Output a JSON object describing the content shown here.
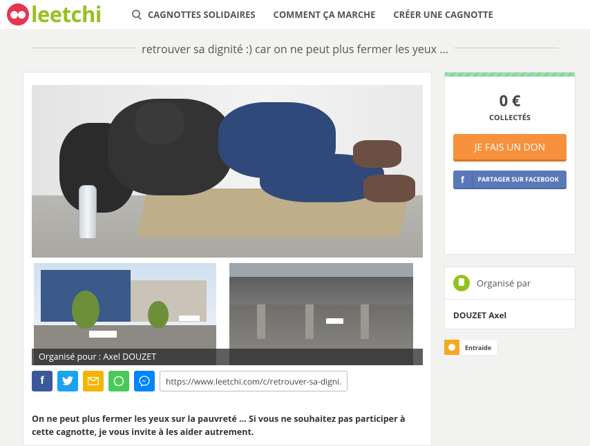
{
  "header": {
    "logo_text": "leetchi",
    "nav": [
      {
        "label": "CAGNOTTES SOLIDAIRES",
        "icon": "search-icon"
      },
      {
        "label": "COMMENT ÇA MARCHE"
      },
      {
        "label": "CRÉER UNE CAGNOTTE"
      }
    ]
  },
  "page": {
    "title": "retrouver sa dignité :) car on ne peut plus fermer les yeux ..."
  },
  "main": {
    "caption": "Organisé pour : Axel DOUZET",
    "share": {
      "icons": [
        "facebook-icon",
        "twitter-icon",
        "email-icon",
        "whatsapp-icon",
        "messenger-icon"
      ],
      "url": "https://www.leetchi.com/c/retrouver-sa-digni..."
    },
    "description": "On ne peut plus fermer les yeux sur la pauvreté ... Si vous ne souhaitez pas participer à cette cagnotte, je vous invite à les aider autrement."
  },
  "sidebar": {
    "amount": "0 €",
    "collected_label": "COLLECTÉS",
    "donate_label": "JE FAIS UN DON",
    "facebook_label": "PARTAGER SUR FACEBOOK",
    "organizer_heading": "Organisé par",
    "organizer_name": "DOUZET Axel",
    "tag_label": "Entraide"
  },
  "colors": {
    "brand_red": "#e8344e",
    "brand_green": "#95c11f",
    "donate_orange": "#f7913d",
    "facebook_blue": "#5b78b8"
  }
}
